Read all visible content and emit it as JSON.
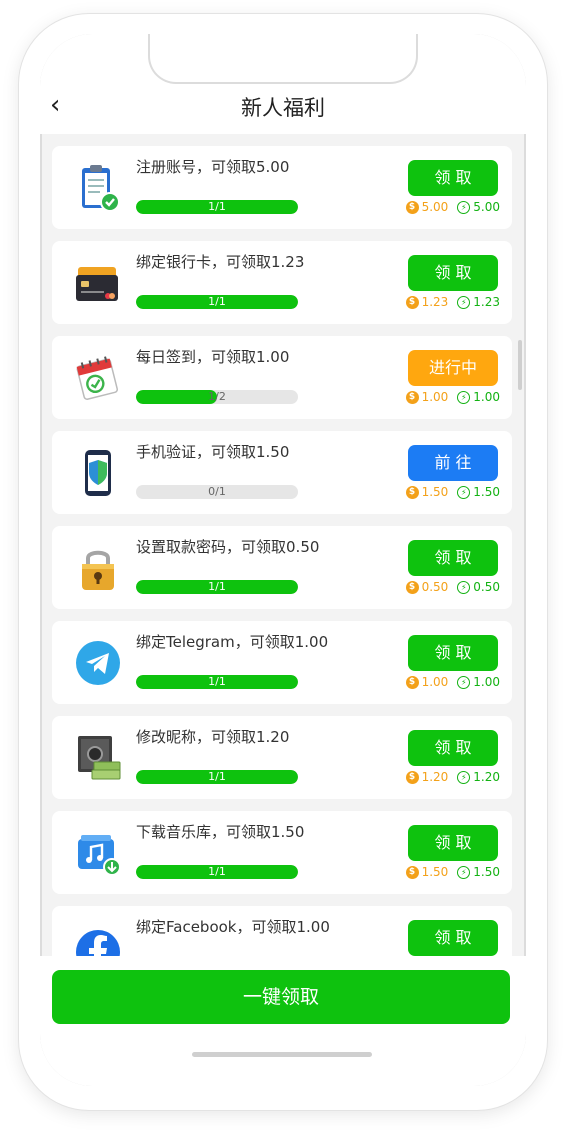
{
  "header": {
    "back_icon": "‹",
    "title": "新人福利"
  },
  "tasks": [
    {
      "title": "注册账号，可领取5.00",
      "progress": "1/1",
      "progress_fraction": 1.0,
      "button": "领 取",
      "button_color": "green",
      "coin_amount": "5.00",
      "bonus_amount": "5.00",
      "icon": "clipboard-check-icon"
    },
    {
      "title": "绑定银行卡，可领取1.23",
      "progress": "1/1",
      "progress_fraction": 1.0,
      "button": "领 取",
      "button_color": "green",
      "coin_amount": "1.23",
      "bonus_amount": "1.23",
      "icon": "bank-card-icon"
    },
    {
      "title": "每日签到，可领取1.00",
      "progress": "1/2",
      "progress_fraction": 0.5,
      "button": "进行中",
      "button_color": "orange",
      "coin_amount": "1.00",
      "bonus_amount": "1.00",
      "icon": "calendar-check-icon"
    },
    {
      "title": "手机验证，可领取1.50",
      "progress": "0/1",
      "progress_fraction": 0.0,
      "button": "前 往",
      "button_color": "blue",
      "coin_amount": "1.50",
      "bonus_amount": "1.50",
      "icon": "phone-shield-icon"
    },
    {
      "title": "设置取款密码，可领取0.50",
      "progress": "1/1",
      "progress_fraction": 1.0,
      "button": "领 取",
      "button_color": "green",
      "coin_amount": "0.50",
      "bonus_amount": "0.50",
      "icon": "padlock-icon"
    },
    {
      "title": "绑定Telegram，可领取1.00",
      "progress": "1/1",
      "progress_fraction": 1.0,
      "button": "领 取",
      "button_color": "green",
      "coin_amount": "1.00",
      "bonus_amount": "1.00",
      "icon": "telegram-icon"
    },
    {
      "title": "修改昵称，可领取1.20",
      "progress": "1/1",
      "progress_fraction": 1.0,
      "button": "领 取",
      "button_color": "green",
      "coin_amount": "1.20",
      "bonus_amount": "1.20",
      "icon": "safe-money-icon"
    },
    {
      "title": "下载音乐库，可领取1.50",
      "progress": "1/1",
      "progress_fraction": 1.0,
      "button": "领 取",
      "button_color": "green",
      "coin_amount": "1.50",
      "bonus_amount": "1.50",
      "icon": "music-download-icon"
    },
    {
      "title": "绑定Facebook，可领取1.00",
      "button": "领 取",
      "button_color": "green",
      "icon": "facebook-icon"
    }
  ],
  "footer": {
    "claim_all_label": "一键领取"
  },
  "colors": {
    "green": "#0ec20e",
    "orange": "#ffa70f",
    "blue": "#1c7cf4",
    "coin": "#f3a11a"
  }
}
